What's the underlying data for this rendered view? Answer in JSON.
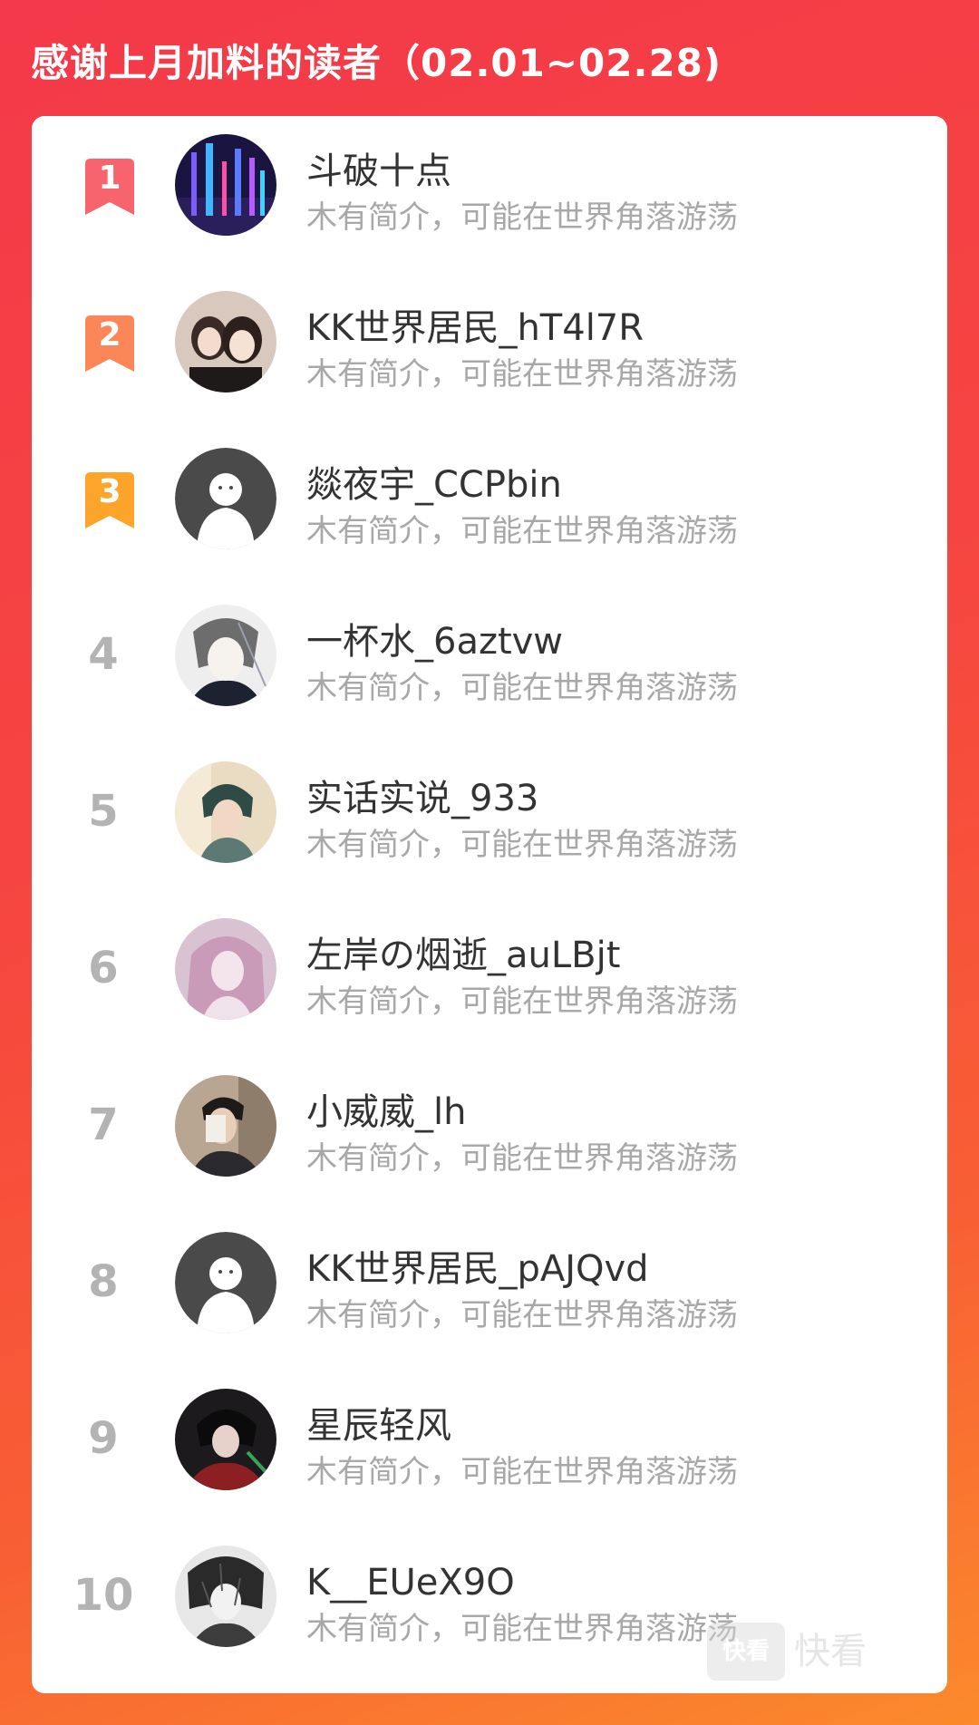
{
  "header": {
    "title": "感谢上月加料的读者（02.01~02.28)"
  },
  "colors": {
    "background_top": "#f4394a",
    "background_bottom": "#fb8a2c",
    "rank1": "#f8646e",
    "rank2": "#fb8758",
    "rank3": "#fda52b",
    "rank_gray": "#b3b3b3",
    "name_text": "#333333",
    "bio_text": "#a8a8a8"
  },
  "readers": [
    {
      "rank": "1",
      "name": "斗破十点",
      "bio": "木有简介，可能在世界角落游荡",
      "avatar": "city-night-avatar"
    },
    {
      "rank": "2",
      "name": "KK世界居民_hT4l7R",
      "bio": "木有简介，可能在世界角落游荡",
      "avatar": "two-girls-photo-avatar"
    },
    {
      "rank": "3",
      "name": "燚夜宇_CCPbin",
      "bio": "木有简介，可能在世界角落游荡",
      "avatar": "default-avatar"
    },
    {
      "rank": "4",
      "name": "一杯水_6aztvw",
      "bio": "木有简介，可能在世界角落游荡",
      "avatar": "anime-sketch-avatar"
    },
    {
      "rank": "5",
      "name": "实话实说_933",
      "bio": "木有简介，可能在世界角落游荡",
      "avatar": "anime-boy-avatar"
    },
    {
      "rank": "6",
      "name": "左岸の烟逝_auLBjt",
      "bio": "木有简介，可能在世界角落游荡",
      "avatar": "pink-anime-girl-avatar"
    },
    {
      "rank": "7",
      "name": "小威威_lh",
      "bio": "木有简介，可能在世界角落游荡",
      "avatar": "man-photo-avatar"
    },
    {
      "rank": "8",
      "name": "KK世界居民_pAJQvd",
      "bio": "木有简介，可能在世界角落游荡",
      "avatar": "default-avatar"
    },
    {
      "rank": "9",
      "name": "星辰轻风",
      "bio": "木有简介，可能在世界角落游荡",
      "avatar": "dark-anime-avatar"
    },
    {
      "rank": "10",
      "name": "K__EUeX9O",
      "bio": "木有简介，可能在世界角落游荡",
      "avatar": "sketch-character-avatar"
    }
  ],
  "watermark": {
    "logo_text": "快看",
    "brand_text": "快看"
  }
}
